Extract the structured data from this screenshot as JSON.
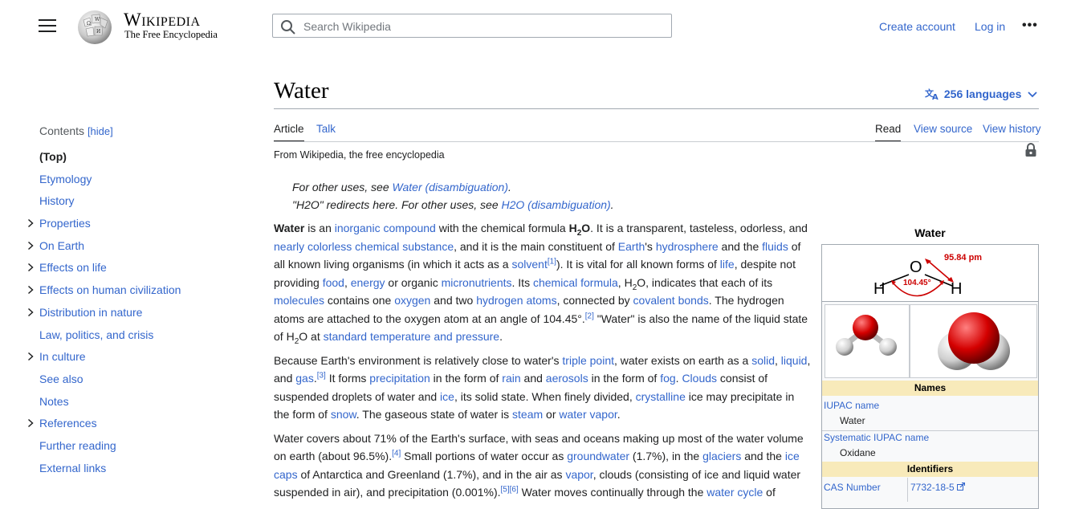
{
  "header": {
    "wordmark": "Wikipedia",
    "tagline": "The Free Encyclopedia",
    "search_placeholder": "Search Wikipedia",
    "create_account": "Create account",
    "login": "Log in",
    "more": "•••"
  },
  "toc": {
    "title": "Contents",
    "hide_label": "[hide]",
    "items": [
      {
        "label": "(Top)",
        "expandable": false
      },
      {
        "label": "Etymology",
        "expandable": false
      },
      {
        "label": "History",
        "expandable": false
      },
      {
        "label": "Properties",
        "expandable": true
      },
      {
        "label": "On Earth",
        "expandable": true
      },
      {
        "label": "Effects on life",
        "expandable": true
      },
      {
        "label": "Effects on human civilization",
        "expandable": true
      },
      {
        "label": "Distribution in nature",
        "expandable": true
      },
      {
        "label": "Law, politics, and crisis",
        "expandable": false
      },
      {
        "label": "In culture",
        "expandable": true
      },
      {
        "label": "See also",
        "expandable": false
      },
      {
        "label": "Notes",
        "expandable": false
      },
      {
        "label": "References",
        "expandable": true
      },
      {
        "label": "Further reading",
        "expandable": false
      },
      {
        "label": "External links",
        "expandable": false
      }
    ]
  },
  "article": {
    "title": "Water",
    "languages": "256 languages",
    "tabs_left": [
      "Article",
      "Talk"
    ],
    "tabs_right": [
      "Read",
      "View source",
      "View history"
    ],
    "from": "From Wikipedia, the free encyclopedia",
    "hatnote1": {
      "text": "For other uses, see ",
      "link": "Water (disambiguation)",
      "end": "."
    },
    "hatnote2": {
      "text": "\"H2O\" redirects here. For other uses, see ",
      "link": "H2O (disambiguation)",
      "end": "."
    },
    "paragraphs": [
      [
        {
          "t": "Water",
          "b": true
        },
        {
          "t": " is an "
        },
        {
          "t": "inorganic compound",
          "l": true
        },
        {
          "t": " with the chemical formula "
        },
        {
          "t": "H",
          "b": true
        },
        {
          "t": "2",
          "sub": true,
          "b": true
        },
        {
          "t": "O",
          "b": true
        },
        {
          "t": ". It is a transparent, tasteless, odorless, and "
        },
        {
          "t": "nearly colorless chemical substance",
          "l": true
        },
        {
          "t": ", and it is the main constituent of "
        },
        {
          "t": "Earth",
          "l": true
        },
        {
          "t": "'s "
        },
        {
          "t": "hydrosphere",
          "l": true
        },
        {
          "t": " and the "
        },
        {
          "t": "fluids",
          "l": true
        },
        {
          "t": " of all known living organisms (in which it acts as a "
        },
        {
          "t": "solvent",
          "l": true
        },
        {
          "t": "[1]",
          "sup": true,
          "l": true
        },
        {
          "t": "). It is vital for all known forms of "
        },
        {
          "t": "life",
          "l": true
        },
        {
          "t": ", despite not providing "
        },
        {
          "t": "food",
          "l": true
        },
        {
          "t": ", "
        },
        {
          "t": "energy",
          "l": true
        },
        {
          "t": " or organic "
        },
        {
          "t": "micronutrients",
          "l": true
        },
        {
          "t": ". Its "
        },
        {
          "t": "chemical formula",
          "l": true
        },
        {
          "t": ", H"
        },
        {
          "t": "2",
          "sub": true
        },
        {
          "t": "O, indicates that each of its "
        },
        {
          "t": "molecules",
          "l": true
        },
        {
          "t": " contains one "
        },
        {
          "t": "oxygen",
          "l": true
        },
        {
          "t": " and two "
        },
        {
          "t": "hydrogen atoms",
          "l": true
        },
        {
          "t": ", connected by "
        },
        {
          "t": "covalent bonds",
          "l": true
        },
        {
          "t": ". The hydrogen atoms are attached to the oxygen atom at an angle of 104.45°."
        },
        {
          "t": "[2]",
          "sup": true,
          "l": true
        },
        {
          "t": " \"Water\" is also the name of the liquid state of H"
        },
        {
          "t": "2",
          "sub": true
        },
        {
          "t": "O at "
        },
        {
          "t": "standard temperature and pressure",
          "l": true
        },
        {
          "t": "."
        }
      ],
      [
        {
          "t": "Because Earth's environment is relatively close to water's "
        },
        {
          "t": "triple point",
          "l": true
        },
        {
          "t": ", water exists on earth as a "
        },
        {
          "t": "solid",
          "l": true
        },
        {
          "t": ", "
        },
        {
          "t": "liquid",
          "l": true
        },
        {
          "t": ", and "
        },
        {
          "t": "gas",
          "l": true
        },
        {
          "t": ".",
          "l": false
        },
        {
          "t": "[3]",
          "sup": true,
          "l": true
        },
        {
          "t": " It forms "
        },
        {
          "t": "precipitation",
          "l": true
        },
        {
          "t": " in the form of "
        },
        {
          "t": "rain",
          "l": true
        },
        {
          "t": " and "
        },
        {
          "t": "aerosols",
          "l": true
        },
        {
          "t": " in the form of "
        },
        {
          "t": "fog",
          "l": true
        },
        {
          "t": ". "
        },
        {
          "t": "Clouds",
          "l": true
        },
        {
          "t": " consist of suspended droplets of water and "
        },
        {
          "t": "ice",
          "l": true
        },
        {
          "t": ", its solid state. When finely divided, "
        },
        {
          "t": "crystalline",
          "l": true
        },
        {
          "t": " ice may precipitate in the form of "
        },
        {
          "t": "snow",
          "l": true
        },
        {
          "t": ". The gaseous state of water is "
        },
        {
          "t": "steam",
          "l": true
        },
        {
          "t": " or "
        },
        {
          "t": "water vapor",
          "l": true
        },
        {
          "t": "."
        }
      ],
      [
        {
          "t": "Water covers about 71% of the Earth's surface, with seas and oceans making up most of the water volume on earth (about 96.5%)."
        },
        {
          "t": "[4]",
          "sup": true,
          "l": true
        },
        {
          "t": " Small portions of water occur as "
        },
        {
          "t": "groundwater",
          "l": true
        },
        {
          "t": " (1.7%), in the "
        },
        {
          "t": "glaciers",
          "l": true
        },
        {
          "t": " and the "
        },
        {
          "t": "ice caps",
          "l": true
        },
        {
          "t": " of Antarctica and Greenland (1.7%), and in the air as "
        },
        {
          "t": "vapor",
          "l": true
        },
        {
          "t": ", clouds (consisting of ice and liquid water suspended in air), and precipitation (0.001%)."
        },
        {
          "t": "[5][6]",
          "sup": true,
          "l": true
        },
        {
          "t": " Water moves continually through the "
        },
        {
          "t": "water cycle",
          "l": true
        },
        {
          "t": " of"
        }
      ]
    ]
  },
  "infobox": {
    "title": "Water",
    "diagram": {
      "o": "O",
      "h1": "H",
      "h2": "H",
      "angle": "104.45°",
      "length": "95.84 pm"
    },
    "names_header": "Names",
    "iupac_label": "IUPAC name",
    "iupac_value": "Water",
    "sys_label": "Systematic IUPAC name",
    "sys_value": "Oxidane",
    "identifiers_header": "Identifiers",
    "cas_label": "CAS Number",
    "cas_value": "7732-18-5"
  },
  "colors": {
    "link": "#3366cc",
    "text": "#202122",
    "infobox_header": "#f8eaba",
    "diagram_red": "#cc0000"
  }
}
